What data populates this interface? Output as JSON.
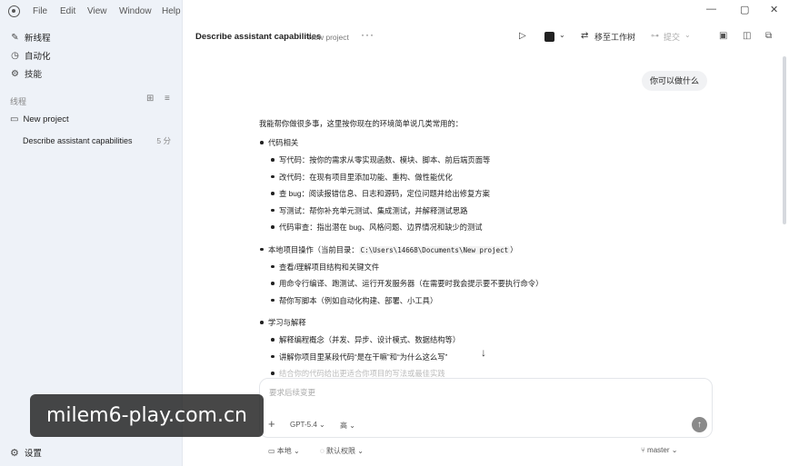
{
  "menubar": {
    "items": [
      "File",
      "Edit",
      "View",
      "Window",
      "Help"
    ]
  },
  "sidebar": {
    "nav": [
      {
        "icon": "new-thread-icon",
        "label": "新线程"
      },
      {
        "icon": "automation-icon",
        "label": "自动化"
      },
      {
        "icon": "skills-icon",
        "label": "技能"
      }
    ],
    "threads_header": "线程",
    "project": "New project",
    "thread": {
      "title": "Describe assistant capabilities",
      "time": "5 分"
    },
    "settings_label": "设置"
  },
  "topbar": {
    "title": "Describe assistant capabilities",
    "project": "New project",
    "more": "···",
    "move_to_worktree": "移至工作树",
    "submit": "提交"
  },
  "conversation": {
    "user_message": "你可以做什么",
    "intro": "我能帮你做很多事，这里按你现在的环境简单说几类常用的：",
    "sections": [
      {
        "title": "代码相关",
        "items": [
          "写代码：按你的需求从零实现函数、模块、脚本、前后端页面等",
          "改代码：在现有项目里添加功能、重构、做性能优化",
          "查 bug：阅读报错信息、日志和源码，定位问题并给出修复方案",
          "写测试：帮你补充单元测试、集成测试，并解释测试思路",
          "代码审查：指出潜在 bug、风格问题、边界情况和缺少的测试"
        ]
      },
      {
        "title_prefix": "本地项目操作（当前目录：",
        "path": "C:\\Users\\14668\\Documents\\New project",
        "title_suffix": "）",
        "items": [
          "查看/理解项目结构和关键文件",
          "用命令行编译、跑测试、运行开发服务器（在需要时我会提示要不要执行命令）",
          "帮你写脚本（例如自动化构建、部署、小工具）"
        ]
      },
      {
        "title": "学习与解释",
        "items": [
          "解释编程概念（并发、异步、设计模式、数据结构等）",
          "讲解你项目里某段代码“是在干嘛”和“为什么这么写”",
          "结合你的代码给出更适合你项目的写法或最佳实践"
        ]
      }
    ]
  },
  "composer": {
    "placeholder": "要求后续变更",
    "model": "GPT-5.4",
    "effort": "高"
  },
  "footer": {
    "local": "本地",
    "permission": "默认权限",
    "branch": "master"
  },
  "watermark": "milem6-play.com.cn"
}
